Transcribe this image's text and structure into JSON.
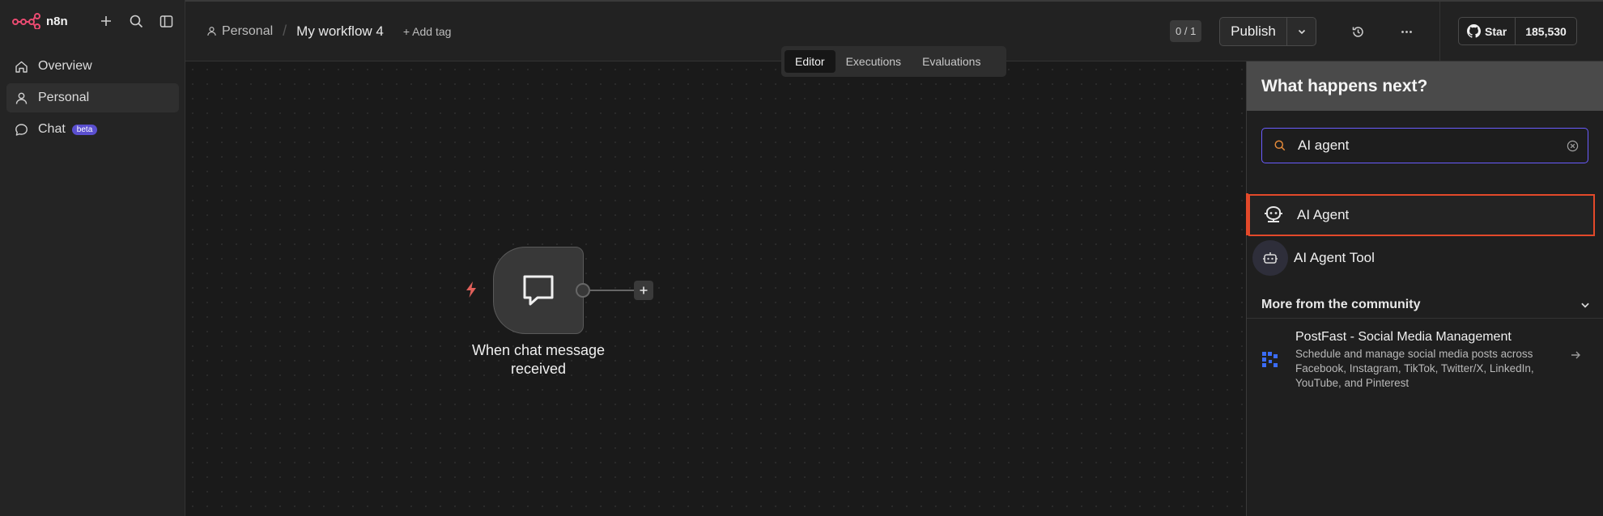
{
  "app": {
    "logo_text": "n8n"
  },
  "sidebar": {
    "items": [
      {
        "label": "Overview",
        "icon": "home-icon"
      },
      {
        "label": "Personal",
        "icon": "user-icon",
        "active": true
      },
      {
        "label": "Chat",
        "icon": "chat-icon",
        "badge": "beta"
      }
    ]
  },
  "header": {
    "breadcrumb_project": "Personal",
    "workflow_name": "My workflow 4",
    "add_tag": "+ Add tag",
    "counter": "0 / 1",
    "publish_label": "Publish",
    "github_star_label": "Star",
    "github_star_count": "185,530"
  },
  "tabs": [
    {
      "label": "Editor",
      "active": true
    },
    {
      "label": "Executions"
    },
    {
      "label": "Evaluations"
    }
  ],
  "canvas": {
    "node_label": "When chat message received"
  },
  "panel": {
    "title": "What happens next?",
    "search_value": "AI agent",
    "results": [
      {
        "label": "AI Agent",
        "icon": "ai-agent-icon",
        "selected": true
      },
      {
        "label": "AI Agent Tool",
        "icon": "robot-icon"
      }
    ],
    "community_header": "More from the community",
    "community_item": {
      "title": "PostFast - Social Media Management",
      "description": "Schedule and manage social media posts across Facebook, Instagram, TikTok, Twitter/X, LinkedIn, YouTube, and Pinterest"
    }
  },
  "colors": {
    "brand": "#ea4b71",
    "accent": "#6a5cff",
    "selection": "#e3492a",
    "trigger": "#e0605a"
  }
}
